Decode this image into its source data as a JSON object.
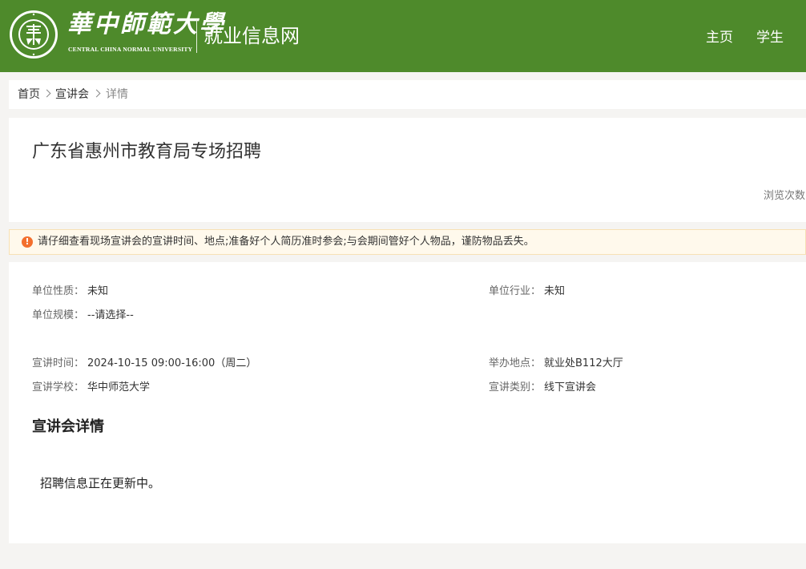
{
  "header": {
    "logo_cn": "華中師範大學",
    "logo_en": "CENTRAL CHINA NORMAL UNIVERSITY",
    "logo_seal_text": "華大",
    "site_name": "就业信息网",
    "nav": [
      {
        "label": "主页"
      },
      {
        "label": "学生"
      }
    ],
    "colors": {
      "header_bg": "#4e8a2b"
    }
  },
  "breadcrumb": {
    "items": [
      {
        "label": "首页"
      },
      {
        "label": "宣讲会"
      },
      {
        "label": "详情"
      }
    ]
  },
  "event": {
    "title": "广东省惠州市教育局专场招聘",
    "views_label": "浏览次数"
  },
  "notice": {
    "icon": "exclamation-icon",
    "text": "请仔细查看现场宣讲会的宣讲时间、地点;准备好个人简历准时参会;与会期间管好个人物品，谨防物品丢失。",
    "colors": {
      "bg": "#fff9ec",
      "icon": "#f36f2d"
    }
  },
  "details": {
    "nature": {
      "label": "单位性质：",
      "value": "未知"
    },
    "industry": {
      "label": "单位行业：",
      "value": "未知"
    },
    "scale": {
      "label": "单位规模：",
      "value": "--请选择--"
    },
    "time": {
      "label": "宣讲时间：",
      "value": "2024-10-15 09:00-16:00（周二）"
    },
    "place": {
      "label": "举办地点：",
      "value": "就业处B112大厅"
    },
    "school": {
      "label": "宣讲学校：",
      "value": "华中师范大学"
    },
    "type": {
      "label": "宣讲类别：",
      "value": "线下宣讲会"
    }
  },
  "section": {
    "title": "宣讲会详情",
    "content": "招聘信息正在更新中。"
  }
}
